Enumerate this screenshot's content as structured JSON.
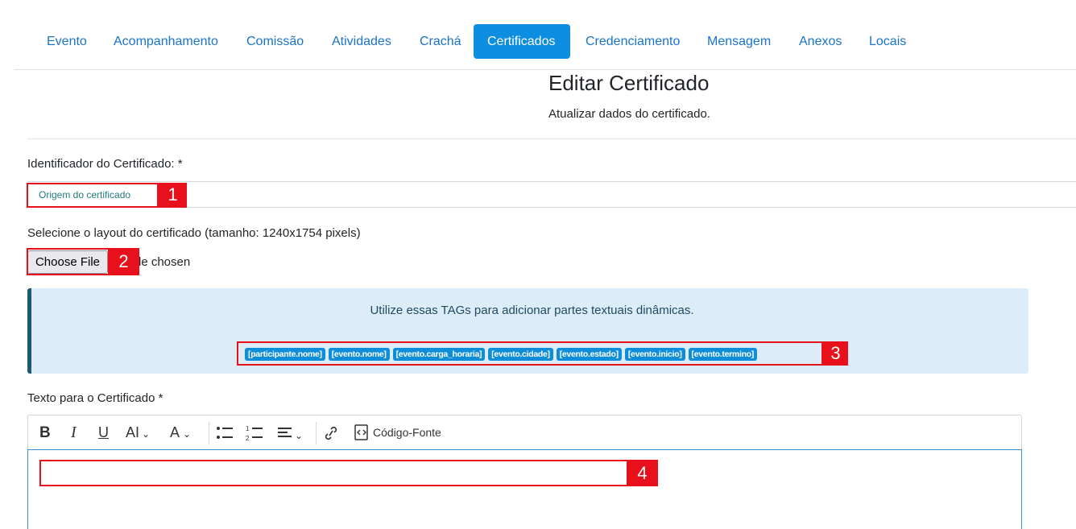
{
  "nav": {
    "tabs": [
      {
        "label": "Evento",
        "active": false
      },
      {
        "label": "Acompanhamento",
        "active": false
      },
      {
        "label": "Comissão",
        "active": false
      },
      {
        "label": "Atividades",
        "active": false
      },
      {
        "label": "Crachá",
        "active": false
      },
      {
        "label": "Certificados",
        "active": true
      },
      {
        "label": "Credenciamento",
        "active": false
      },
      {
        "label": "Mensagem",
        "active": false
      },
      {
        "label": "Anexos",
        "active": false
      },
      {
        "label": "Locais",
        "active": false
      }
    ]
  },
  "header": {
    "title": "Editar Certificado",
    "subtitle": "Atualizar dados do certificado."
  },
  "form": {
    "identifier_label": "Identificador do Certificado: *",
    "identifier_value": "Origem do certificado",
    "layout_label": "Selecione o layout do certificado (tamanho: 1240x1754 pixels)",
    "file_button": "Choose File",
    "file_status": "le chosen",
    "text_label": "Texto para o Certificado *"
  },
  "alert": {
    "text": "Utilize essas TAGs para adicionar partes textuais dinâmicas.",
    "tags": [
      "[participante.nome]",
      "[evento.nome]",
      "[evento.carga_horaria]",
      "[evento.cidade]",
      "[evento.estado]",
      "[evento.inicio]",
      "[evento.termino]"
    ]
  },
  "editor": {
    "toolbar": {
      "bold": "B",
      "italic": "I",
      "underline": "U",
      "font_size": "AI",
      "format": "A",
      "source_label": "Código-Fonte"
    }
  },
  "annotations": [
    "1",
    "2",
    "3",
    "4"
  ],
  "colors": {
    "accent": "#0d8ee0",
    "annotation": "#e8101a",
    "tag": "#0e8ed8",
    "alert_bg": "#dcecf8"
  }
}
